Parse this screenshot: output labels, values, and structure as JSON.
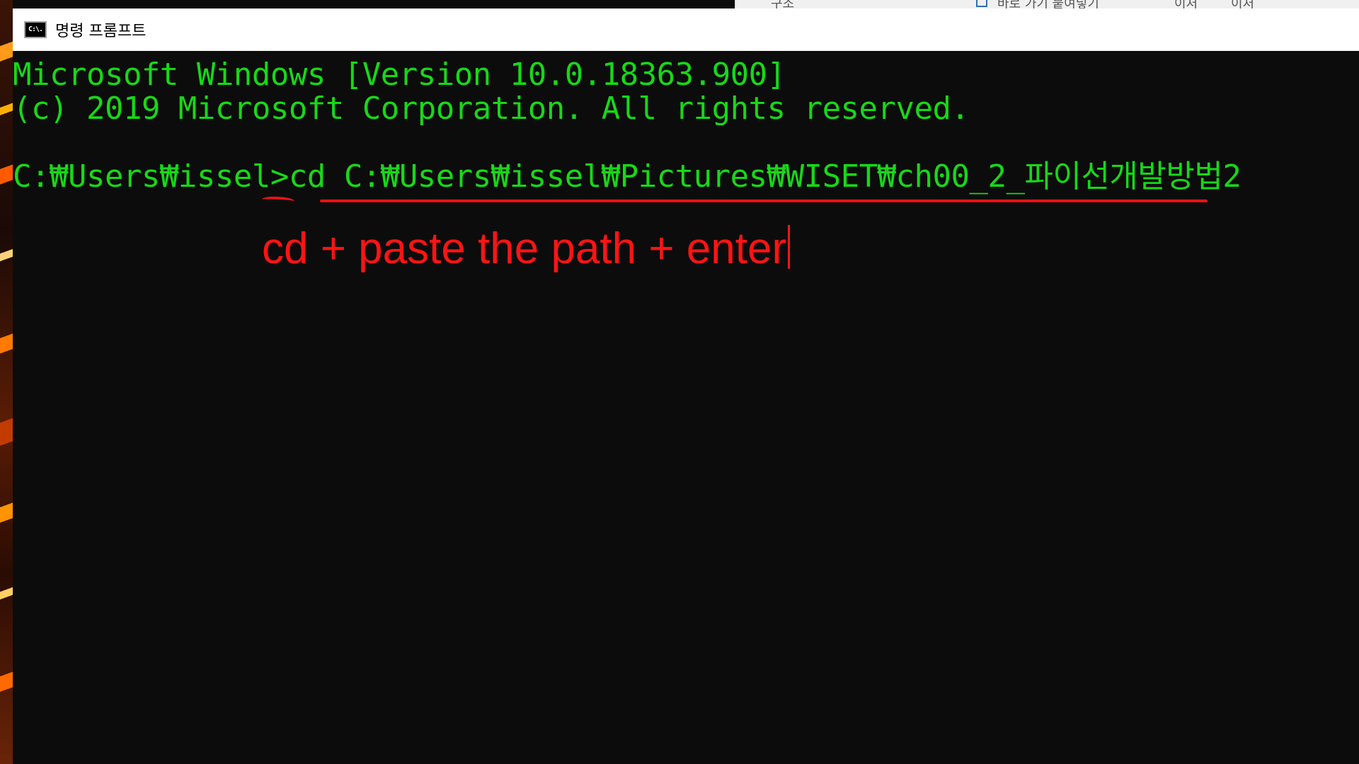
{
  "window": {
    "title": "명령 프롬프트",
    "icon_name": "cmd-app-icon",
    "icon_glyph": "C:\\."
  },
  "background_window": {
    "items": [
      "구조",
      "바로 가기 붙여넣기",
      "이처",
      "이처"
    ]
  },
  "console": {
    "line_1": "Microsoft Windows [Version 10.0.18363.900]",
    "line_2": "(c) 2019 Microsoft Corporation. All rights reserved.",
    "prompt": "C:₩Users₩issel>",
    "command": "cd",
    "argument": "C:₩Users₩issel₩Pictures₩WISET₩ch00_2_파이선개발방법2",
    "text_color": "#16d916",
    "background_color": "#0c0c0c"
  },
  "annotation": {
    "text": "cd + paste the path + enter",
    "color": "#ff1414"
  }
}
